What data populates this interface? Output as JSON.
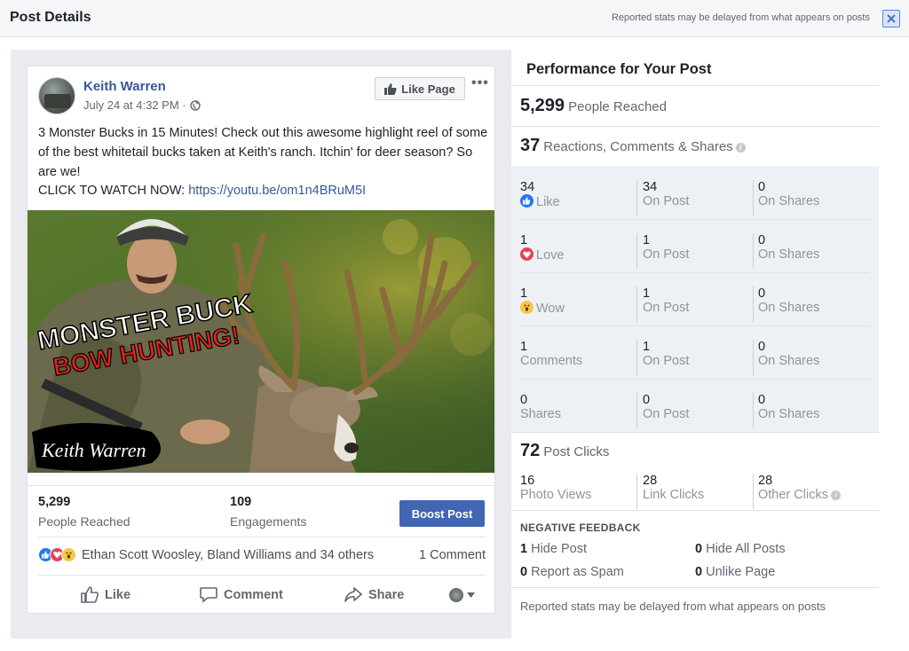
{
  "header": {
    "title": "Post Details",
    "note": "Reported stats may be delayed from what appears on posts"
  },
  "post": {
    "page_name": "Keith Warren",
    "date": "July 24 at 4:32 PM ·",
    "like_page_label": "Like Page",
    "more_label": "•••",
    "text": "3 Monster Bucks in 15 Minutes! Check out this awesome highlight reel of some of the best whitetail bucks taken at Keith's ranch. Itchin' for deer season? So are we!",
    "cta_prefix": "CLICK TO WATCH NOW: ",
    "cta_link": "https://youtu.be/om1n4BRuM5I",
    "image": {
      "title_line1": "MONSTER BUCK",
      "title_line2": "BOW HUNTING!",
      "signature": "Keith Warren"
    },
    "stats": {
      "reached_value": "5,299",
      "reached_label": "People Reached",
      "engagements_value": "109",
      "engagements_label": "Engagements",
      "boost_label": "Boost Post"
    },
    "reactions_text": "Ethan Scott Woosley, Bland Williams and 34 others",
    "comments_text": "1 Comment",
    "actions": {
      "like": "Like",
      "comment": "Comment",
      "share": "Share"
    }
  },
  "performance": {
    "title": "Performance for Your Post",
    "reached_value": "5,299",
    "reached_label": "People Reached",
    "rcs_value": "37",
    "rcs_label": "Reactions, Comments & Shares",
    "rows": [
      {
        "value": "34",
        "label": "Like",
        "icon": "like-icon",
        "on_post_value": "34",
        "on_post_label": "On Post",
        "on_shares_value": "0",
        "on_shares_label": "On Shares"
      },
      {
        "value": "1",
        "label": "Love",
        "icon": "love-icon",
        "on_post_value": "1",
        "on_post_label": "On Post",
        "on_shares_value": "0",
        "on_shares_label": "On Shares"
      },
      {
        "value": "1",
        "label": "Wow",
        "icon": "wow-icon",
        "on_post_value": "1",
        "on_post_label": "On Post",
        "on_shares_value": "0",
        "on_shares_label": "On Shares"
      },
      {
        "value": "1",
        "label": "Comments",
        "icon": "",
        "on_post_value": "1",
        "on_post_label": "On Post",
        "on_shares_value": "0",
        "on_shares_label": "On Shares"
      },
      {
        "value": "0",
        "label": "Shares",
        "icon": "",
        "on_post_value": "0",
        "on_post_label": "On Post",
        "on_shares_value": "0",
        "on_shares_label": "On Shares"
      }
    ],
    "clicks_value": "72",
    "clicks_label": "Post Clicks",
    "photo_views_value": "16",
    "photo_views_label": "Photo Views",
    "link_clicks_value": "28",
    "link_clicks_label": "Link Clicks",
    "other_clicks_value": "28",
    "other_clicks_label": "Other Clicks",
    "negative_title": "NEGATIVE FEEDBACK",
    "hide_post_value": "1",
    "hide_post_label": "Hide Post",
    "hide_all_value": "0",
    "hide_all_label": "Hide All Posts",
    "spam_value": "0",
    "spam_label": "Report as Spam",
    "unlike_value": "0",
    "unlike_label": "Unlike Page",
    "footer": "Reported stats may be delayed from what appears on posts"
  },
  "colors": {
    "link": "#385898",
    "boost": "#4267b2",
    "like_blue": "#2078f4",
    "love_red": "#e84155",
    "wow_yellow": "#f7c64a"
  }
}
